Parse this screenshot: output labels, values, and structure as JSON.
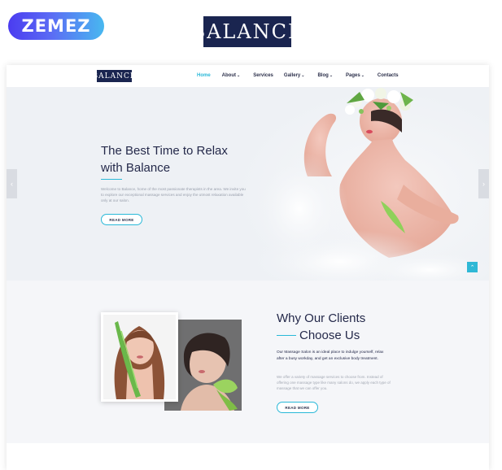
{
  "promo": {
    "vendor_badge": "ZEMEZ",
    "brand_logo": "BALANCE"
  },
  "nav": {
    "logo": "BALANCE",
    "items": [
      {
        "label": "Home",
        "active": true,
        "has_dropdown": false
      },
      {
        "label": "About",
        "active": false,
        "has_dropdown": true
      },
      {
        "label": "Services",
        "active": false,
        "has_dropdown": false
      },
      {
        "label": "Gallery",
        "active": false,
        "has_dropdown": true
      },
      {
        "label": "Blog",
        "active": false,
        "has_dropdown": true
      },
      {
        "label": "Pages",
        "active": false,
        "has_dropdown": true
      },
      {
        "label": "Contacts",
        "active": false,
        "has_dropdown": false
      }
    ]
  },
  "hero": {
    "title_line1": "The Best Time to Relax",
    "title_line2": "with Balance",
    "text": "Welcome to Balance, home of the most passionate therapists in the area. We invite you to explore our exceptional massage services and enjoy the utmost relaxation available only at our salon.",
    "button": "READ MORE",
    "prev_icon": "chevron-left-icon",
    "next_icon": "chevron-right-icon",
    "scroll_top_icon": "arrow-up-icon"
  },
  "why": {
    "title_line1": "Why Our Clients",
    "title_line2": "Choose Us",
    "lead": "Our Massage Salon is an ideal place to indulge yourself, relax after a busy workday, and get an exclusive body treatment.",
    "text": "We offer a variety of massage services to choose from. Instead of offering one massage type like many salons do, we apply each type of massage that we can offer you.",
    "button": "READ MORE"
  },
  "colors": {
    "accent": "#29b8d8",
    "navy": "#1a2550",
    "hero_bg": "#eef1f5"
  }
}
